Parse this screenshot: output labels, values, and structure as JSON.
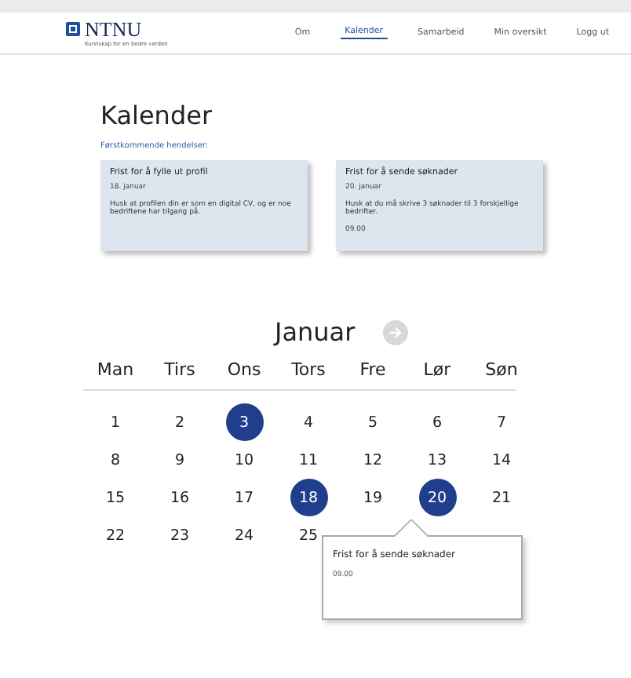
{
  "header": {
    "logo": "NTNU",
    "tagline": "Kunnskap for en bedre verden",
    "nav": [
      {
        "label": "Om",
        "selected": false
      },
      {
        "label": "Kalender",
        "selected": true
      },
      {
        "label": "Samarbeid",
        "selected": false
      },
      {
        "label": "Min oversikt",
        "selected": false
      },
      {
        "label": "Logg ut",
        "selected": false
      }
    ]
  },
  "title": "Kalender",
  "upcoming_label": "Førstkommende hendelser:",
  "events": [
    {
      "title": "Frist for å fylle ut profil",
      "date": "18. januar",
      "text": "Husk at profilen din er som en digital CV, og er noe bedriftene har tilgang på."
    },
    {
      "title": "Frist for å sende søknader",
      "date": "20. januar",
      "text": "Husk at du må skrive 3 søknader til 3 forskjellige bedrifter.",
      "time": "09.00"
    }
  ],
  "calendar": {
    "month": "Januar",
    "weekdays": [
      "Man",
      "Tirs",
      "Ons",
      "Tors",
      "Fre",
      "Lør",
      "Søn"
    ],
    "days": [
      {
        "label": "1",
        "has_event": false
      },
      {
        "label": "2",
        "has_event": false
      },
      {
        "label": "3",
        "has_event": true
      },
      {
        "label": "4",
        "has_event": false
      },
      {
        "label": "5",
        "has_event": false
      },
      {
        "label": "6",
        "has_event": false
      },
      {
        "label": "7",
        "has_event": false
      },
      {
        "label": "8",
        "has_event": false
      },
      {
        "label": "9",
        "has_event": false
      },
      {
        "label": "10",
        "has_event": false
      },
      {
        "label": "11",
        "has_event": false
      },
      {
        "label": "12",
        "has_event": false
      },
      {
        "label": "13",
        "has_event": false
      },
      {
        "label": "14",
        "has_event": false
      },
      {
        "label": "15",
        "has_event": false
      },
      {
        "label": "16",
        "has_event": false
      },
      {
        "label": "17",
        "has_event": false
      },
      {
        "label": "18",
        "has_event": true
      },
      {
        "label": "19",
        "has_event": false
      },
      {
        "label": "20",
        "has_event": true
      },
      {
        "label": "21",
        "has_event": false
      },
      {
        "label": "22",
        "has_event": false
      },
      {
        "label": "23",
        "has_event": false
      },
      {
        "label": "24",
        "has_event": false
      },
      {
        "label": "25",
        "has_event": false
      }
    ],
    "popup": {
      "title": "Frist for å sende søknader",
      "time": "09.00"
    }
  }
}
